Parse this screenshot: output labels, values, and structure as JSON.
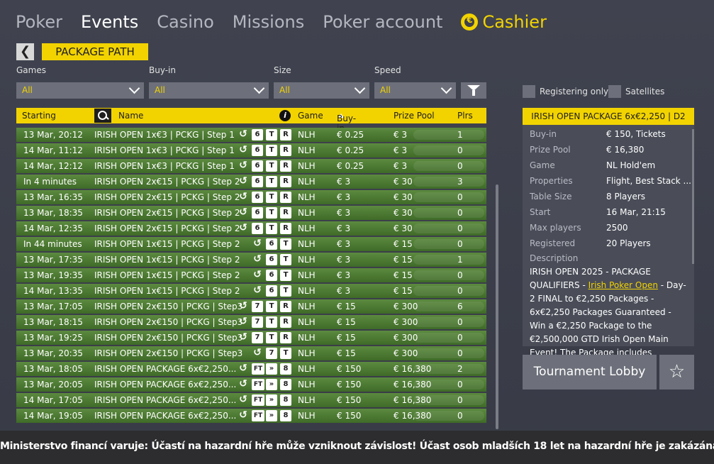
{
  "nav": {
    "items": [
      "Poker",
      "Events",
      "Casino",
      "Missions",
      "Poker account"
    ],
    "cashier": "Cashier"
  },
  "package_path": "PACKAGE PATH",
  "filters": {
    "games": {
      "label": "Games",
      "value": "All"
    },
    "buyin": {
      "label": "Buy-in",
      "value": "All"
    },
    "size": {
      "label": "Size",
      "value": "All"
    },
    "speed": {
      "label": "Speed",
      "value": "All"
    }
  },
  "checkboxes": {
    "registering_only": "Registering only",
    "satellites": "Satellites"
  },
  "table": {
    "headers": {
      "starting": "Starting",
      "name": "Name",
      "game": "Game",
      "buyin": "Buy-in",
      "prize": "Prize Pool",
      "plrs": "Plrs"
    },
    "rows": [
      {
        "start": "13 Mar, 20:12",
        "name": "IRISH OPEN 1x€3 | PCKG | Step 1",
        "badges": [
          "↺",
          "6",
          "T",
          "R"
        ],
        "game": "NLH",
        "buyin": "€ 0.25",
        "prize": "€ 3",
        "plrs": "1"
      },
      {
        "start": "14 Mar, 11:12",
        "name": "IRISH OPEN 1x€3 | PCKG | Step 1",
        "badges": [
          "↺",
          "6",
          "T",
          "R"
        ],
        "game": "NLH",
        "buyin": "€ 0.25",
        "prize": "€ 3",
        "plrs": "0"
      },
      {
        "start": "14 Mar, 12:12",
        "name": "IRISH OPEN 1x€3 | PCKG | Step 1",
        "badges": [
          "↺",
          "6",
          "T",
          "R"
        ],
        "game": "NLH",
        "buyin": "€ 0.25",
        "prize": "€ 3",
        "plrs": "0"
      },
      {
        "start": "In 4 minutes",
        "name": "IRISH OPEN 2x€15 | PCKG | Step 2",
        "badges": [
          "↺",
          "6",
          "T",
          "R"
        ],
        "game": "NLH",
        "buyin": "€ 3",
        "prize": "€ 30",
        "plrs": "3"
      },
      {
        "start": "13 Mar, 16:35",
        "name": "IRISH OPEN 2x€15 | PCKG | Step 2",
        "badges": [
          "↺",
          "6",
          "T",
          "R"
        ],
        "game": "NLH",
        "buyin": "€ 3",
        "prize": "€ 30",
        "plrs": "0"
      },
      {
        "start": "13 Mar, 18:35",
        "name": "IRISH OPEN 2x€15 | PCKG | Step 2",
        "badges": [
          "↺",
          "6",
          "T",
          "R"
        ],
        "game": "NLH",
        "buyin": "€ 3",
        "prize": "€ 30",
        "plrs": "0"
      },
      {
        "start": "14 Mar, 12:35",
        "name": "IRISH OPEN 2x€15 | PCKG | Step 2",
        "badges": [
          "↺",
          "6",
          "T",
          "R"
        ],
        "game": "NLH",
        "buyin": "€ 3",
        "prize": "€ 30",
        "plrs": "0"
      },
      {
        "start": "In 44 minutes",
        "name": "IRISH OPEN 1x€15 | PCKG | Step 2",
        "badges": [
          "↺",
          "6",
          "T"
        ],
        "game": "NLH",
        "buyin": "€ 3",
        "prize": "€ 15",
        "plrs": "0"
      },
      {
        "start": "13 Mar, 17:35",
        "name": "IRISH OPEN 1x€15 | PCKG | Step 2",
        "badges": [
          "↺",
          "6",
          "T"
        ],
        "game": "NLH",
        "buyin": "€ 3",
        "prize": "€ 15",
        "plrs": "1"
      },
      {
        "start": "13 Mar, 19:35",
        "name": "IRISH OPEN 1x€15 | PCKG | Step 2",
        "badges": [
          "↺",
          "6",
          "T"
        ],
        "game": "NLH",
        "buyin": "€ 3",
        "prize": "€ 15",
        "plrs": "0"
      },
      {
        "start": "14 Mar, 13:35",
        "name": "IRISH OPEN 1x€15 | PCKG | Step 2",
        "badges": [
          "↺",
          "6",
          "T"
        ],
        "game": "NLH",
        "buyin": "€ 3",
        "prize": "€ 15",
        "plrs": "0"
      },
      {
        "start": "13 Mar, 17:05",
        "name": "IRISH OPEN 2x€150 | PCKG | Step3",
        "badges": [
          "↺",
          "7",
          "T",
          "R"
        ],
        "game": "NLH",
        "buyin": "€ 15",
        "prize": "€ 300",
        "plrs": "6"
      },
      {
        "start": "13 Mar, 18:15",
        "name": "IRISH OPEN 2x€150 | PCKG | Step3",
        "badges": [
          "↺",
          "7",
          "T",
          "R"
        ],
        "game": "NLH",
        "buyin": "€ 15",
        "prize": "€ 300",
        "plrs": "0"
      },
      {
        "start": "13 Mar, 19:25",
        "name": "IRISH OPEN 2x€150 | PCKG | Step3",
        "badges": [
          "↺",
          "7",
          "T",
          "R"
        ],
        "game": "NLH",
        "buyin": "€ 15",
        "prize": "€ 300",
        "plrs": "0"
      },
      {
        "start": "13 Mar, 20:35",
        "name": "IRISH OPEN 2x€150 | PCKG | Step3",
        "badges": [
          "↺",
          "7",
          "T"
        ],
        "game": "NLH",
        "buyin": "€ 15",
        "prize": "€ 300",
        "plrs": "0"
      },
      {
        "start": "13 Mar, 18:05",
        "name": "IRISH OPEN PACKAGE 6x€2,250...",
        "badges": [
          "↺",
          "FT",
          "»",
          "8"
        ],
        "game": "NLH",
        "buyin": "€ 150",
        "prize": "€ 16,380",
        "plrs": "2"
      },
      {
        "start": "13 Mar, 20:05",
        "name": "IRISH OPEN PACKAGE 6x€2,250...",
        "badges": [
          "↺",
          "FT",
          "»",
          "8"
        ],
        "game": "NLH",
        "buyin": "€ 150",
        "prize": "€ 16,380",
        "plrs": "0"
      },
      {
        "start": "14 Mar, 17:05",
        "name": "IRISH OPEN PACKAGE 6x€2,250...",
        "badges": [
          "↺",
          "FT",
          "»",
          "8"
        ],
        "game": "NLH",
        "buyin": "€ 150",
        "prize": "€ 16,380",
        "plrs": "0"
      },
      {
        "start": "14 Mar, 19:05",
        "name": "IRISH OPEN PACKAGE 6x€2,250...",
        "badges": [
          "↺",
          "FT",
          "»",
          "8"
        ],
        "game": "NLH",
        "buyin": "€ 150",
        "prize": "€ 16,380",
        "plrs": "0"
      }
    ]
  },
  "detail": {
    "title": "IRISH OPEN PACKAGE 6x€2,250 | D2",
    "fields": [
      {
        "label": "Buy-in",
        "value": "€ 150, Tickets"
      },
      {
        "label": "Prize Pool",
        "value": "€ 16,380"
      },
      {
        "label": "Game",
        "value": "NL Hold'em"
      },
      {
        "label": "Properties",
        "value": "Flight, Best Stack ..."
      },
      {
        "label": "Table Size",
        "value": "8 Players"
      },
      {
        "label": "Start",
        "value": "16 Mar, 21:15"
      },
      {
        "label": "Max players",
        "value": "2500"
      },
      {
        "label": "Registered",
        "value": "20 Players"
      }
    ],
    "description_label": "Description",
    "description_pre": "IRISH OPEN 2025 - PACKAGE QUALIFIERS - ",
    "description_link": "Irish Poker Open",
    "description_post": " - Day-2 FINAL to €2,250 Packages - 6x€2,250 Packages Guaranteed - Win a €2,250 Package to the €2,500,000 GTD Irish Open Main Event! The Package includes"
  },
  "lobby_button": "Tournament Lobby",
  "warning": "Ministerstvo financí varuje: Účastí na hazardní hře může vzniknout závislost! Účast osob mladších 18 let na hazardní hře je zakázána!",
  "colors": {
    "accent": "#f2d300",
    "row_green": "#4e7c34",
    "background": "#3b3e4a"
  },
  "icons": [
    "back-icon",
    "coin-icon",
    "chevron-down-icon",
    "filter-icon",
    "search-icon",
    "info-icon",
    "sort-asc-icon",
    "star-icon"
  ]
}
